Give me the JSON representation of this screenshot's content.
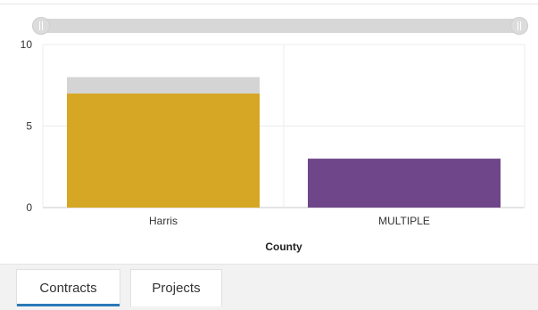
{
  "colors": {
    "bar_primary_harris": "#d6a724",
    "bar_secondary_harris": "#d4d4d4",
    "bar_multiple": "#6e4689",
    "grid": "#ececec",
    "axis": "#c8c8c8",
    "tab_active_underline": "#2a7ab8"
  },
  "chart_data": {
    "type": "bar",
    "stacked": true,
    "xlabel": "County",
    "ylabel": "",
    "ylim": [
      0,
      10
    ],
    "yticks": [
      "0",
      "5",
      "10"
    ],
    "grid": true,
    "categories": [
      "Harris",
      "MULTIPLE"
    ],
    "bars": [
      {
        "category": "Harris",
        "segments": [
          {
            "value": 7,
            "color": "#d6a724"
          },
          {
            "value": 1,
            "color": "#d4d4d4"
          }
        ]
      },
      {
        "category": "MULTIPLE",
        "segments": [
          {
            "value": 3,
            "color": "#6e4689"
          }
        ]
      }
    ]
  },
  "slider": {
    "range_start": 0,
    "range_end": 1
  },
  "tabs": [
    {
      "label": "Contracts",
      "active": true
    },
    {
      "label": "Projects",
      "active": false
    }
  ]
}
